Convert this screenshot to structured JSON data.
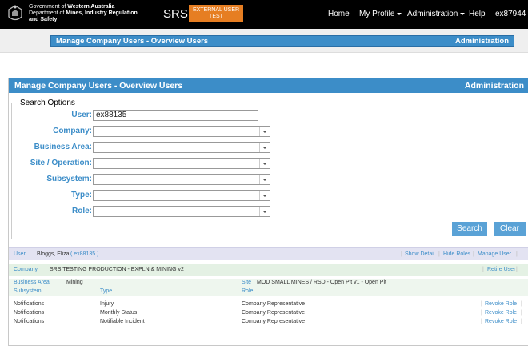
{
  "navbar": {
    "gov_line1_pre": "Government of ",
    "gov_line1_bold": "Western Australia",
    "gov_line2_pre": "Department of ",
    "gov_line2_bold": "Mines, Industry Regulation",
    "gov_line3": "and Safety",
    "app_name": "SRS",
    "env_badge_line1": "EXTERNAL USER",
    "env_badge_line2": "TEST",
    "home": "Home",
    "my_profile": "My Profile",
    "administration": "Administration",
    "help": "Help",
    "user": "ex87944"
  },
  "breadcrumb": {
    "title": "Manage Company Users - Overview Users",
    "section": "Administration"
  },
  "panel": {
    "title": "Manage Company Users - Overview Users",
    "section": "Administration"
  },
  "search": {
    "legend": "Search Options",
    "fields": {
      "user_label": "User:",
      "user_value": "ex88135",
      "company_label": "Company:",
      "business_area_label": "Business Area:",
      "site_label": "Site / Operation:",
      "subsystem_label": "Subsystem:",
      "type_label": "Type:",
      "role_label": "Role:"
    },
    "search_button": "Search",
    "clear_button": "Clear"
  },
  "results": {
    "user_heading": "User",
    "user_name": "Bloggs, Eliza",
    "user_id": "( ex88135 )",
    "show_detail": "Show Detail",
    "hide_roles": "Hide Roles",
    "manage_user": "Manage User",
    "company_heading": "Company",
    "company_name": "SRS TESTING PRODUCTION - EXPLN & MINING v2",
    "retire_user": "Retire User",
    "business_area_heading": "Business Area",
    "business_area_value": "Mining",
    "site_heading": "Site",
    "site_value": "MOD SMALL MINES / RSD - Open Pit v1 - Open Pit",
    "columns": {
      "subsystem": "Subsystem",
      "type": "Type",
      "role": "Role"
    },
    "rows": [
      {
        "subsystem": "Notifications",
        "type": "Injury",
        "role": "Company Representative",
        "action": "Revoke Role"
      },
      {
        "subsystem": "Notifications",
        "type": "Monthly Status",
        "role": "Company Representative",
        "action": "Revoke Role"
      },
      {
        "subsystem": "Notifications",
        "type": "Notifiable Incident",
        "role": "Company Representative",
        "action": "Revoke Role"
      }
    ]
  }
}
